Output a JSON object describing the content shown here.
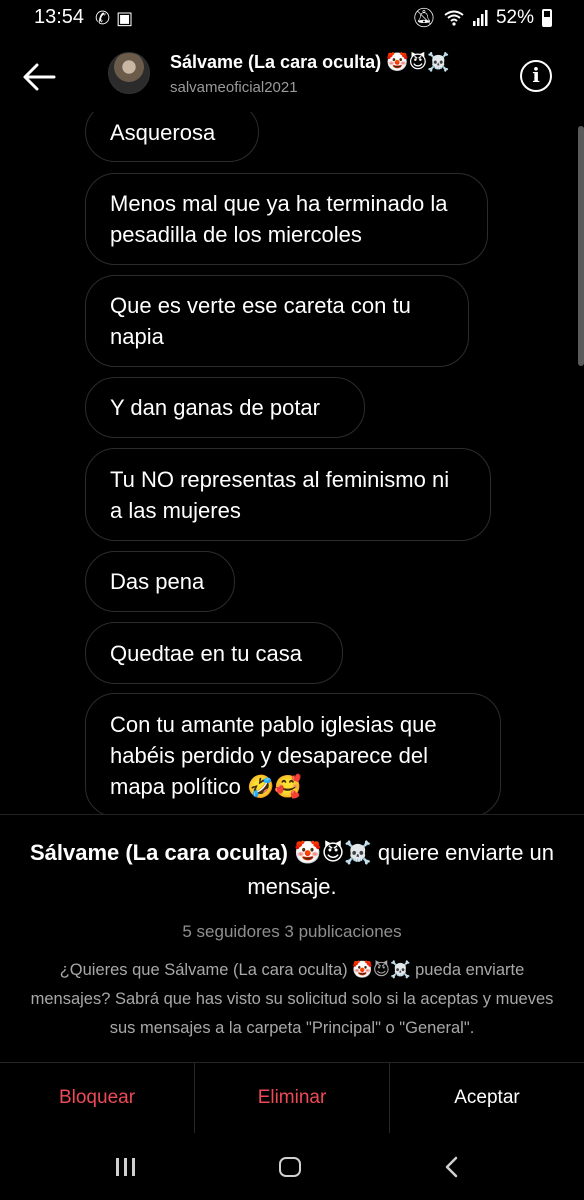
{
  "status": {
    "time": "13:54",
    "battery": "52%"
  },
  "header": {
    "title": "Sálvame (La cara oculta) 🤡😈☠️",
    "username": "salvameoficial2021"
  },
  "messages": [
    "Asquerosa",
    "Menos mal que ya ha terminado la pesadilla de los miercoles",
    "Que es verte ese careta con tu napia",
    "Y dan ganas de potar",
    "Tu NO representas al feminismo ni a las mujeres",
    "Das pena",
    "Quedtae en tu casa",
    "Con tu amante pablo iglesias que habéis perdido y desaparece del mapa político 🤣🥰"
  ],
  "request": {
    "title_name": "Sálvame (La cara oculta) 🤡😈☠️",
    "title_text": " quiere enviarte un mensaje.",
    "stats": "5 seguidores 3 publicaciones",
    "body": "¿Quieres que Sálvame (La cara oculta) 🤡😈☠️ pueda enviarte mensajes? Sabrá que has visto su solicitud solo si la aceptas y mueves sus mensajes a la carpeta \"Principal\" o \"General\"."
  },
  "actions": {
    "block": "Bloquear",
    "delete": "Eliminar",
    "accept": "Aceptar"
  },
  "colors": {
    "background": "#000000",
    "danger": "#ed4956",
    "bubble_border": "#2c2c2c",
    "muted": "#9a9a9a"
  },
  "icons": {
    "status_left": [
      "whatsapp-icon",
      "image-icon"
    ],
    "status_right": [
      "mute-icon",
      "wifi-icon",
      "signal-icon",
      "battery-icon"
    ],
    "header": [
      "back-arrow-icon",
      "info-icon"
    ],
    "nav": [
      "recents-icon",
      "home-icon",
      "back-icon"
    ]
  }
}
